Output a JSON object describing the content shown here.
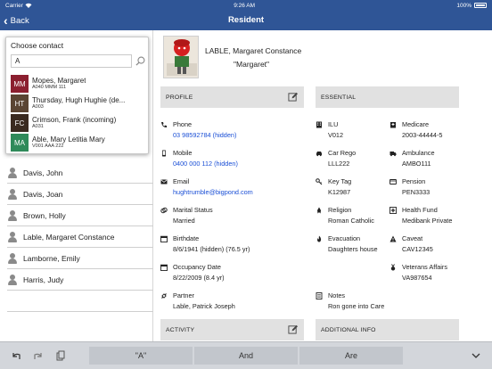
{
  "status_bar": {
    "carrier": "Carrier",
    "wifi_icon": "wifi-icon",
    "time": "9:26 AM",
    "battery": "100%"
  },
  "nav": {
    "back_label": "Back",
    "title": "Resident"
  },
  "popup": {
    "title": "Choose contact",
    "search_value": "A",
    "contacts": [
      {
        "initials": "MM",
        "color": "#8b1f2f",
        "name": "Mopes, Margaret",
        "sub": "A040 MMM 111"
      },
      {
        "initials": "HT",
        "color": "#5a4533",
        "name": "Thursday, Hugh Hughie (de...",
        "sub": "A003"
      },
      {
        "initials": "FC",
        "color": "#3a2a20",
        "name": "Crimson, Frank (incoming)",
        "sub": "A031"
      },
      {
        "initials": "MA",
        "color": "#2f8a5a",
        "name": "Able, Mary Letitia Mary",
        "sub": "V001 AAA 222"
      }
    ]
  },
  "resident_list": [
    "Davis, John",
    "Davis, Joan",
    "Brown, Holly",
    "Lable, Margaret Constance",
    "Lamborne, Emily",
    "Harris, Judy"
  ],
  "resident": {
    "name": "LABLE, Margaret Constance",
    "nickname": "\"Margaret\""
  },
  "sections": {
    "profile": "PROFILE",
    "essential": "ESSENTIAL",
    "activity": "ACTIVITY",
    "additional_info": "ADDITIONAL INFO"
  },
  "profile": {
    "phone": {
      "label": "Phone",
      "value": "03 98592784 (hidden)"
    },
    "mobile": {
      "label": "Mobile",
      "value": "0400 000 112 (hidden)"
    },
    "email": {
      "label": "Email",
      "value": "hughtrumble@bigpond.com"
    },
    "marital": {
      "label": "Marital Status",
      "value": "Married"
    },
    "birthdate": {
      "label": "Birthdate",
      "value": "8/6/1941 (hidden) (76.5 yr)"
    },
    "occupancy": {
      "label": "Occupancy Date",
      "value": "8/22/2009 (8.4 yr)"
    },
    "partner": {
      "label": "Partner",
      "value": "Lable, Patrick Joseph"
    }
  },
  "essential": {
    "ilu": {
      "label": "ILU",
      "value": "V012"
    },
    "car_rego": {
      "label": "Car Rego",
      "value": "LLL222"
    },
    "key_tag": {
      "label": "Key Tag",
      "value": "K12987"
    },
    "religion": {
      "label": "Religion",
      "value": "Roman Catholic"
    },
    "evacuation": {
      "label": "Evacuation",
      "value": "Daughters house"
    },
    "notes": {
      "label": "Notes",
      "value": "Ron gone into Care"
    },
    "medicare": {
      "label": "Medicare",
      "value": "2003-44444-5"
    },
    "ambulance": {
      "label": "Ambulance",
      "value": "AMBO111"
    },
    "pension": {
      "label": "Pension",
      "value": "PEN3333"
    },
    "health_fund": {
      "label": "Health Fund",
      "value": "Medibank Private"
    },
    "caveat": {
      "label": "Caveat",
      "value": "CAV12345"
    },
    "veterans": {
      "label": "Veterans Affairs",
      "value": "VA987654"
    }
  },
  "keyboard_bar": {
    "suggestions": [
      "\"A\"",
      "And",
      "Are"
    ]
  }
}
